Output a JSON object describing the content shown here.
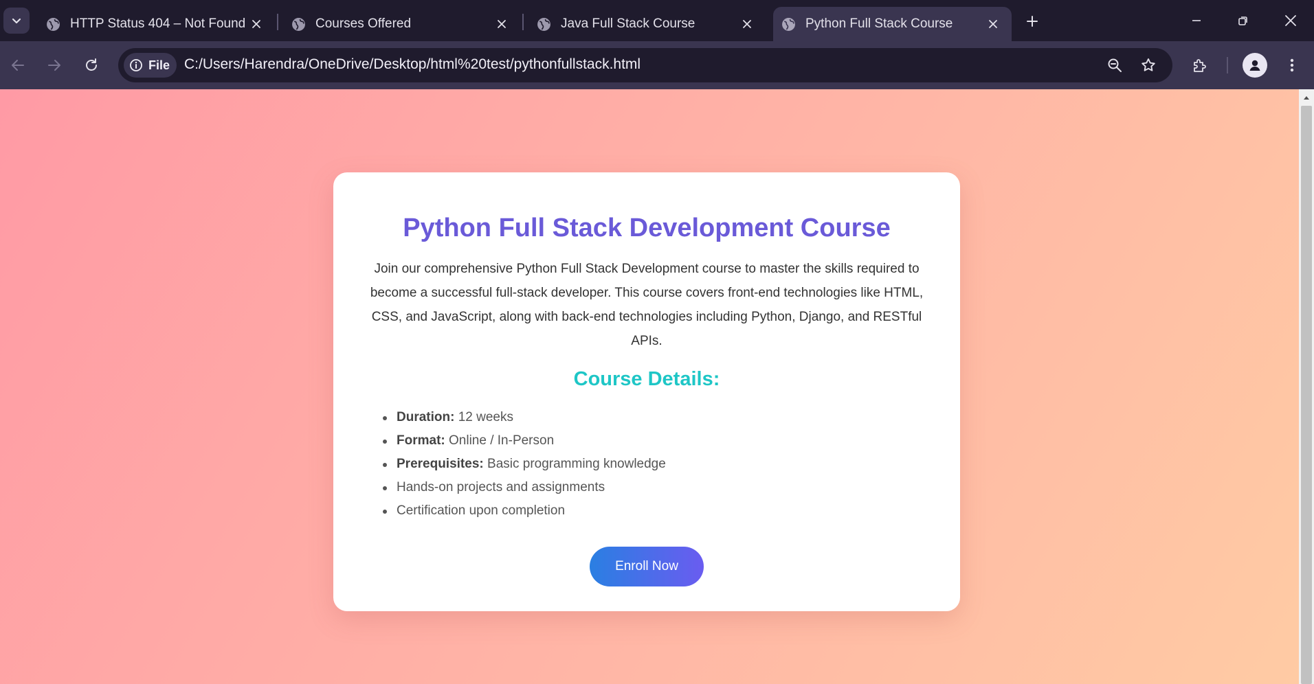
{
  "browser": {
    "tabs": [
      {
        "title": "HTTP Status 404 – Not Found",
        "active": false
      },
      {
        "title": "Courses Offered",
        "active": false
      },
      {
        "title": "Java Full Stack Course",
        "active": false
      },
      {
        "title": "Python Full Stack Course",
        "active": true
      }
    ],
    "address_bar": {
      "scheme_chip": "File",
      "url": "C:/Users/Harendra/OneDrive/Desktop/html%20test/pythonfullstack.html"
    },
    "icons": [
      "tab-search-icon",
      "globe-icon",
      "close-icon",
      "new-tab-icon",
      "minimize-icon",
      "restore-icon",
      "back-icon",
      "forward-icon",
      "reload-icon",
      "info-icon",
      "zoom-icon",
      "bookmark-star-icon",
      "extensions-icon",
      "profile-icon",
      "menu-icon"
    ]
  },
  "page": {
    "title": "Python Full Stack Development Course",
    "intro": "Join our comprehensive Python Full Stack Development course to master the skills required to become a successful full-stack developer. This course covers front-end technologies like HTML, CSS, and JavaScript, along with back-end technologies including Python, Django, and RESTful APIs.",
    "details_heading": "Course Details:",
    "details": [
      {
        "label": "Duration:",
        "value": "12 weeks"
      },
      {
        "label": "Format:",
        "value": "Online / In-Person"
      },
      {
        "label": "Prerequisites:",
        "value": "Basic programming knowledge"
      },
      {
        "label": "",
        "value": "Hands-on projects and assignments"
      },
      {
        "label": "",
        "value": "Certification upon completion"
      }
    ],
    "enroll_button": "Enroll Now"
  },
  "colors": {
    "title": "#6a5ad8",
    "details_heading": "#1ec6c6",
    "button_start": "#2a7fe2",
    "button_end": "#6a5cf0",
    "background_start": "#ff9aa5",
    "background_end": "#ffcba4"
  }
}
